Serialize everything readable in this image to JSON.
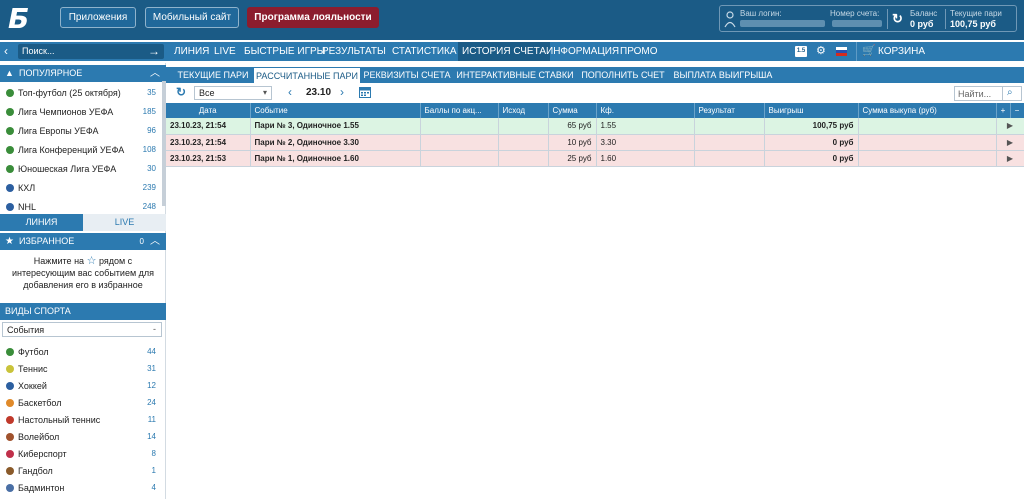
{
  "header": {
    "apps_label": "Приложения",
    "mobile_label": "Мобильный сайт",
    "loyalty_label": "Программа лояльности",
    "login_label": "Ваш логин:",
    "account_number_label": "Номер счета:",
    "balance_label": "Баланс",
    "balance_value": "0 руб",
    "current_bets_label": "Текущие пари",
    "current_bets_value": "100,75 руб"
  },
  "nav": {
    "search_placeholder": "Поиск...",
    "items": [
      "ЛИНИЯ",
      "LIVE",
      "БЫСТРЫЕ ИГРЫ",
      "РЕЗУЛЬТАТЫ",
      "СТАТИСТИКА",
      "ИСТОРИЯ СЧЕТА",
      "ИНФОРМАЦИЯ",
      "ПРОМО"
    ],
    "badge": "1.5",
    "cart_label": "КОРЗИНА"
  },
  "sidebar": {
    "popular_title": "ПОПУЛЯРНОЕ",
    "popular": [
      {
        "label": "Топ-футбол (25 октября)",
        "count": "35"
      },
      {
        "label": "Лига Чемпионов УЕФА",
        "count": "185"
      },
      {
        "label": "Лига Европы УЕФА",
        "count": "96"
      },
      {
        "label": "Лига Конференций УЕФА",
        "count": "108"
      },
      {
        "label": "Юношеская Лига УЕФА",
        "count": "30"
      },
      {
        "label": "КХЛ",
        "count": "239"
      },
      {
        "label": "NHL",
        "count": "248"
      }
    ],
    "tab_line": "ЛИНИЯ",
    "tab_live": "LIVE",
    "favorites_title": "ИЗБРАННОЕ",
    "favorites_count": "0",
    "favorites_info_1": "Нажмите на",
    "favorites_info_2": "рядом с интересующим вас событием для добавления его в избранное",
    "sports_title": "ВИДЫ СПОРТА",
    "sports_filter": "События",
    "sports": [
      {
        "label": "Футбол",
        "count": "44",
        "color": "#3a8d3a"
      },
      {
        "label": "Теннис",
        "count": "31",
        "color": "#c9c33a"
      },
      {
        "label": "Хоккей",
        "count": "12",
        "color": "#2c5fa0"
      },
      {
        "label": "Баскетбол",
        "count": "24",
        "color": "#e08a2a"
      },
      {
        "label": "Настольный теннис",
        "count": "11",
        "color": "#c0392b"
      },
      {
        "label": "Волейбол",
        "count": "14",
        "color": "#a0522d"
      },
      {
        "label": "Киберспорт",
        "count": "8",
        "color": "#c0304a"
      },
      {
        "label": "Гандбол",
        "count": "1",
        "color": "#8a5a2a"
      },
      {
        "label": "Бадминтон",
        "count": "4",
        "color": "#4a6fa5"
      }
    ]
  },
  "main": {
    "tabs": [
      "ТЕКУЩИЕ ПАРИ",
      "РАССЧИТАННЫЕ ПАРИ",
      "РЕКВИЗИТЫ СЧЕТА",
      "ИНТЕРАКТИВНЫЕ СТАВКИ",
      "ПОПОЛНИТЬ СЧЕТ",
      "ВЫПЛАТА ВЫИГРЫША"
    ],
    "filter_value": "Все",
    "date": "23.10",
    "search_placeholder": "Найти...",
    "columns": [
      "Дата",
      "Событие",
      "Баллы по акц...",
      "Исход",
      "Сумма",
      "Кф.",
      "Результат",
      "Выигрыш",
      "Сумма выкупа (руб)",
      "+",
      "−"
    ],
    "rows": [
      {
        "date": "23.10.23, 21:54",
        "event": "Пари № 3, Одиночное 1.55",
        "sum": "65 руб",
        "coef": "1.55",
        "win": "100,75 руб",
        "status": "won"
      },
      {
        "date": "23.10.23, 21:54",
        "event": "Пари № 2, Одиночное 3.30",
        "sum": "10 руб",
        "coef": "3.30",
        "win": "0 руб",
        "status": "lost"
      },
      {
        "date": "23.10.23, 21:53",
        "event": "Пари № 1, Одиночное 1.60",
        "sum": "25 руб",
        "coef": "1.60",
        "win": "0 руб",
        "status": "lost"
      }
    ]
  },
  "colors": {
    "brand": "#1b5b86",
    "accent": "#2c7ab0",
    "loyalty": "#8c1d2e",
    "won_row": "#dcf4e3",
    "lost_row": "#f8e1e1"
  }
}
